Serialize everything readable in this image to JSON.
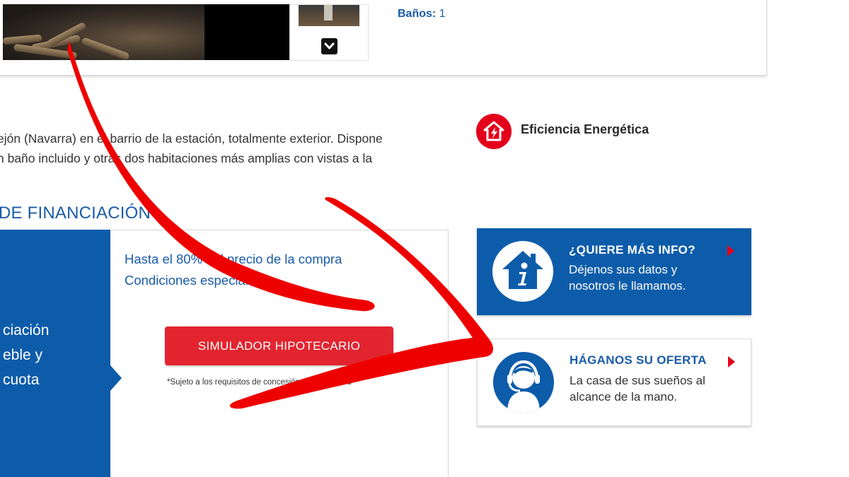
{
  "listing": {
    "banos_label": "Baños:",
    "banos_value": "1"
  },
  "description": {
    "line1": "ejón (Navarra) en el barrio de la estación, totalmente exterior. Dispone",
    "line2": "n baño incluido y otras dos habitaciones más amplias con vistas a la"
  },
  "energy": {
    "label": "Eficiencia Energética"
  },
  "financing": {
    "title": "DE FINANCIACIÓN",
    "blue_line1": "ciación",
    "blue_line2": "eble y",
    "blue_line3": "cuota",
    "line1": "Hasta el 80% del precio de la compra",
    "line2": "Condiciones especiales",
    "button_label": "SIMULADOR HIPOTECARIO",
    "note": "*Sujeto a los requisitos de concesión de préstamos"
  },
  "cta_info": {
    "title": "¿QUIERE MÁS INFO?",
    "line1": "Déjenos sus datos y",
    "line2": "nosotros le llamamos."
  },
  "cta_offer": {
    "title": "HÁGANOS SU OFERTA",
    "line1": "La casa de sus sueños al",
    "line2": "alcance de la mano."
  },
  "colors": {
    "brand_blue": "#0d5caa",
    "accent_red": "#e3001b",
    "button_red": "#e2242f"
  },
  "icons": [
    "chevron-down-icon",
    "energy-house-icon",
    "info-house-icon",
    "agent-headset-icon",
    "arrow-right-icon",
    "annotation-arrow"
  ]
}
